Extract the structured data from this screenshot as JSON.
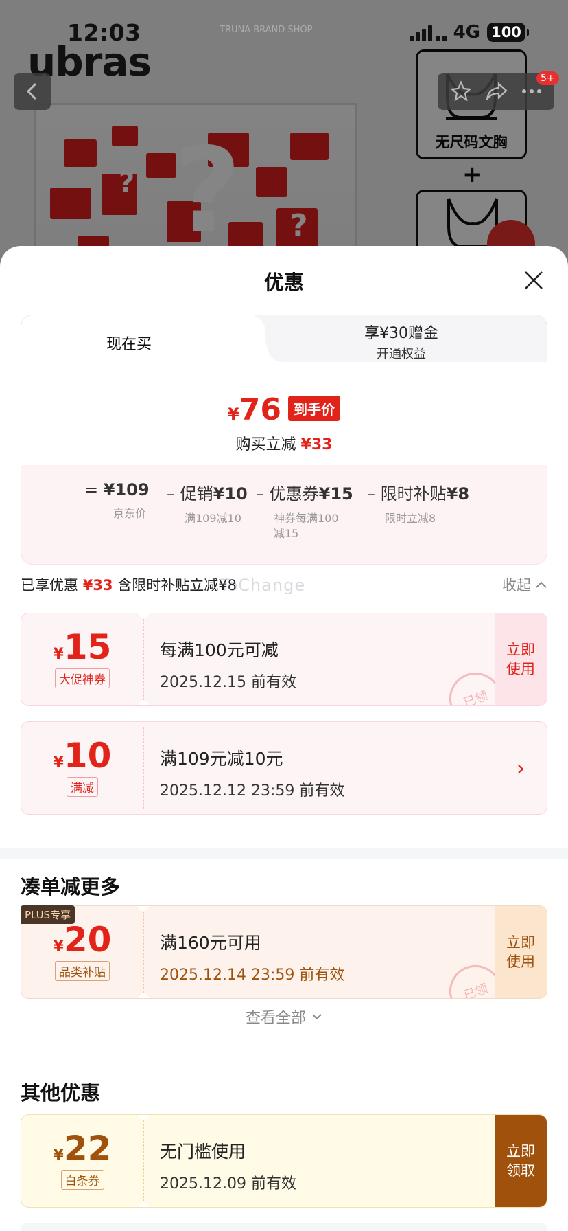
{
  "status_bar": {
    "time": "12:03",
    "network": "4G",
    "battery": "100"
  },
  "background": {
    "brand": "ubras",
    "faint_text": "TRUNA BRAND SHOP",
    "cart_badge": "5+",
    "side_card_label": "无尺码文胸",
    "plus_sign": "+"
  },
  "sheet": {
    "title": "优惠",
    "price_card": {
      "tab_now": "现在买",
      "tab_alt_line1": "享¥30赠金",
      "tab_alt_line2": "开通权益",
      "final_yen": "¥",
      "final_price": "76",
      "final_tag": "到手价",
      "save_label": "购买立减",
      "save_amount": "¥33",
      "formula": [
        {
          "main_a": "= ",
          "main_b": "¥109",
          "sub": "京东价"
        },
        {
          "main_a": "– 促销",
          "main_b": "¥10",
          "sub": "满109减10"
        },
        {
          "main_a": "– 优惠券",
          "main_b": "¥15",
          "sub": "神券每满100\n减15"
        },
        {
          "main_a": "– 限时补贴",
          "main_b": "¥8",
          "sub": "限时立减8"
        }
      ]
    },
    "enjoyed": {
      "prefix": "已享优惠",
      "amount": "¥33",
      "suffix": "含限时补贴立减¥8"
    },
    "watermark": "ToChange",
    "collapse_label": "收起",
    "coupons": [
      {
        "yen": "¥",
        "amount": "15",
        "tag": "大促神券",
        "title": "每满100元可减",
        "date": "2025.12.15 前有效",
        "action": "立即\n使用",
        "stamp": "已领"
      },
      {
        "yen": "¥",
        "amount": "10",
        "tag": "满减",
        "title": "满109元减10元",
        "date": "2025.12.12 23:59 前有效",
        "action": "›"
      }
    ],
    "more_section": {
      "title": "凑单减更多",
      "plus_badge": "PLUS专享",
      "coupon": {
        "yen": "¥",
        "amount": "20",
        "tag": "品类补贴",
        "title": "满160元可用",
        "date": "2025.12.14 23:59 前有效",
        "action": "立即\n使用",
        "stamp": "已领"
      },
      "see_all": "查看全部"
    },
    "other_section": {
      "title": "其他优惠",
      "coupon": {
        "yen": "¥",
        "amount": "22",
        "tag": "白条券",
        "title": "无门槛使用",
        "date": "2025.12.09 前有效",
        "action": "立即\n领取"
      }
    }
  },
  "colors": {
    "accent_red": "#e2231a",
    "brown": "#a0520c",
    "plus_dark": "#4a3526"
  }
}
